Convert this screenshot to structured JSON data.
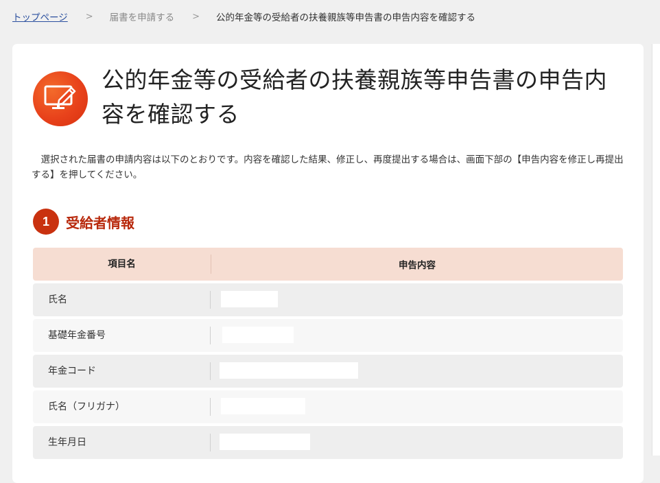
{
  "breadcrumb": {
    "home": "トップページ",
    "step2": "届書を申請する",
    "current": "公的年金等の受給者の扶養親族等申告書の申告内容を確認する",
    "separator": ">"
  },
  "page": {
    "title": "公的年金等の受給者の扶養親族等申告書の申告内容を確認する",
    "intro": "選択された届書の申請内容は以下のとおりです。内容を確認した結果、修正し、再度提出する場合は、画面下部の【申告内容を修正し再提出する】を押してください。",
    "icon": "monitor-edit-icon",
    "accent_color": "#e8421b"
  },
  "section1": {
    "number": "1",
    "title": "受給者情報",
    "title_color": "#b8290c"
  },
  "table": {
    "headers": [
      "項目名",
      "申告内容"
    ],
    "header_bg": "#f6ddd2",
    "rows": [
      {
        "label": "氏名",
        "value": ""
      },
      {
        "label": "基礎年金番号",
        "value": ""
      },
      {
        "label": "年金コード",
        "value": ""
      },
      {
        "label": "氏名（フリガナ）",
        "value": ""
      },
      {
        "label": "生年月日",
        "value": ""
      }
    ]
  }
}
